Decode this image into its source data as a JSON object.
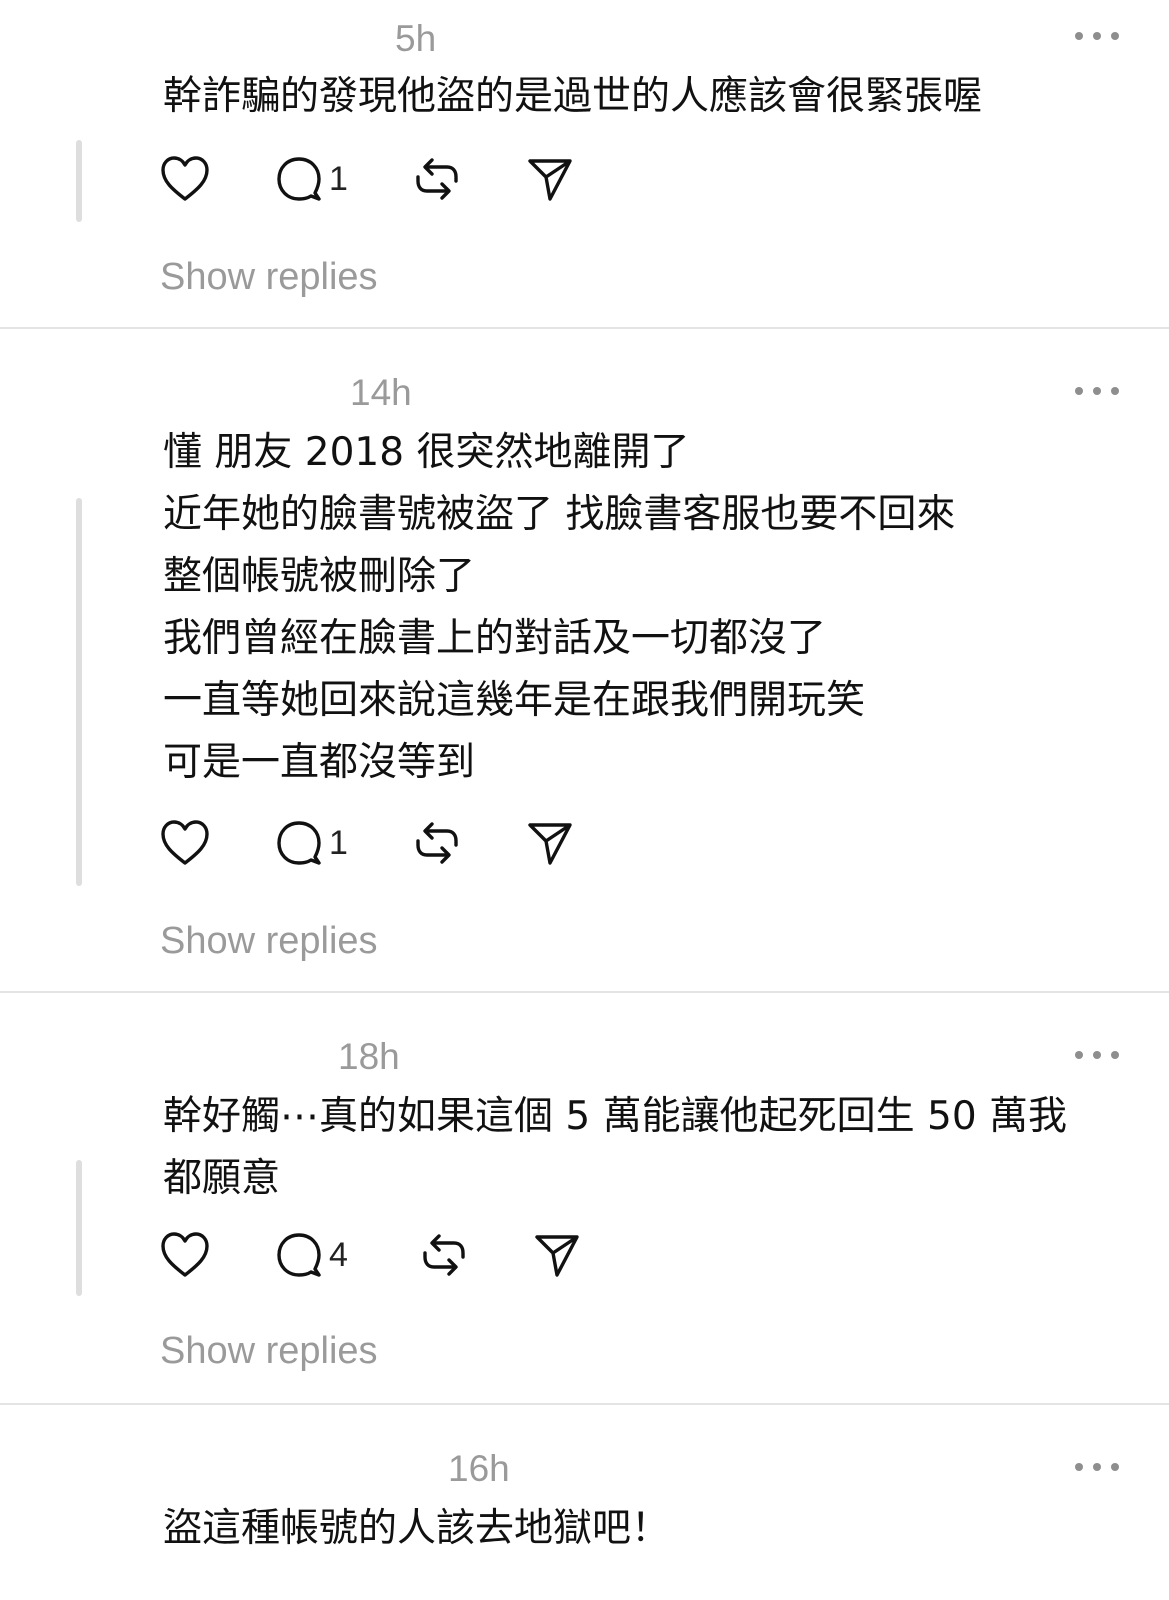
{
  "posts": [
    {
      "time": "5h",
      "text": "幹詐騙的發現他盜的是過世的人應該會很緊張喔",
      "reply_count": "1",
      "show_replies": "Show replies"
    },
    {
      "time": "14h",
      "text": "懂 朋友 2018 很突然地離開了\n近年她的臉書號被盜了 找臉書客服也要不回來\n整個帳號被刪除了\n我們曾經在臉書上的對話及一切都沒了\n一直等她回來說這幾年是在跟我們開玩笑\n可是一直都沒等到",
      "reply_count": "1",
      "show_replies": "Show replies"
    },
    {
      "time": "18h",
      "text": "幹好觸⋯真的如果這個 5 萬能讓他起死回生 50 萬我\n都願意",
      "reply_count": "4",
      "show_replies": "Show replies"
    },
    {
      "time": "16h",
      "text": "盜這種帳號的人該去地獄吧！"
    }
  ],
  "icons": {
    "like": "heart-icon",
    "reply": "comment-bubble-icon",
    "repost": "repost-icon",
    "share": "send-icon",
    "more": "more-dots-icon"
  },
  "colors": {
    "text": "#111111",
    "muted": "#9a9a9a",
    "divider": "#e4e4e4",
    "thread_line": "#dedede"
  }
}
